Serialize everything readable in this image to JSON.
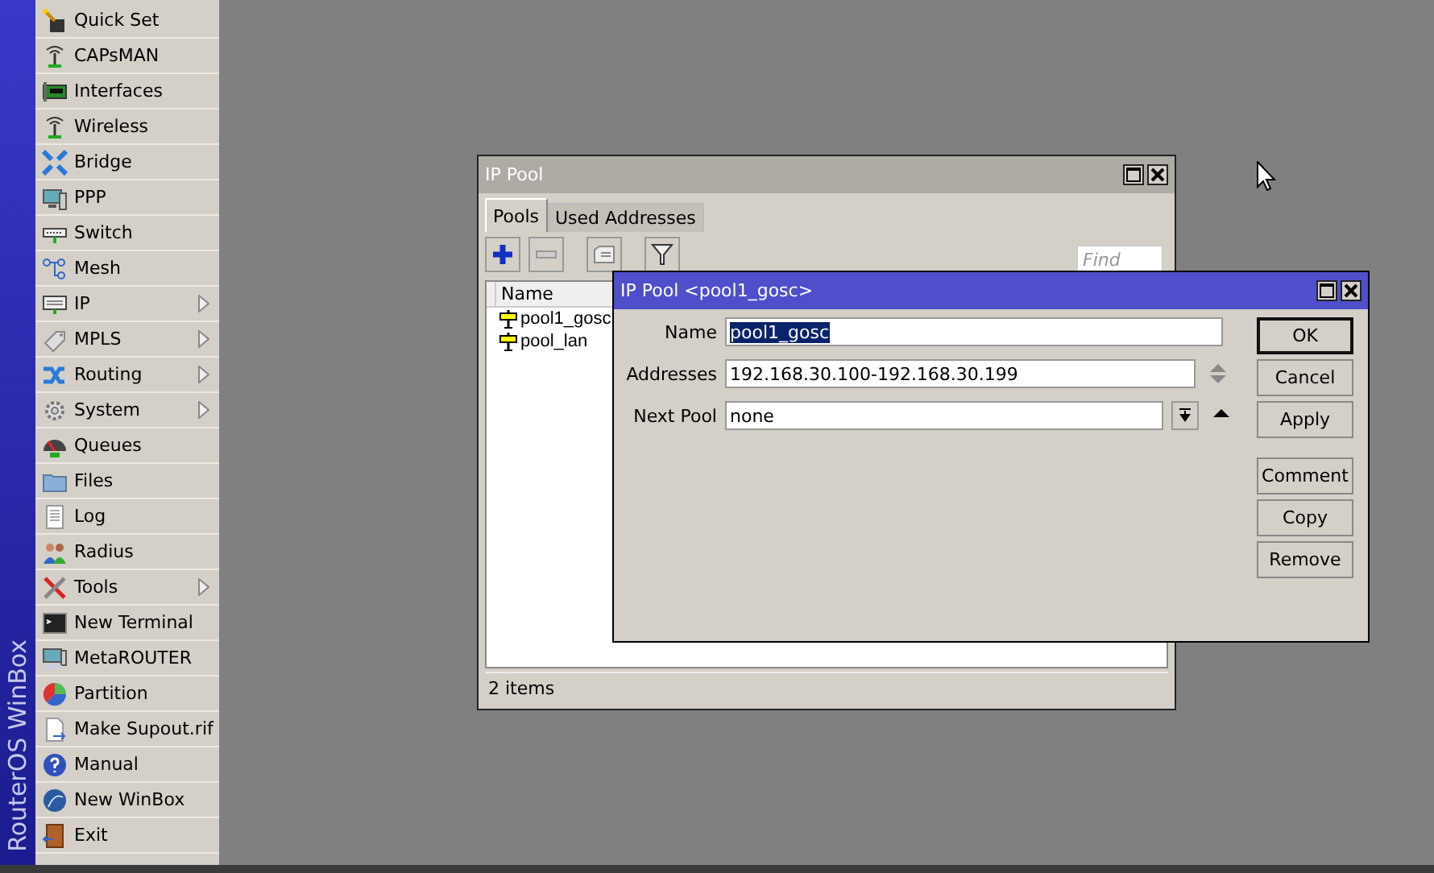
{
  "sidebar": {
    "brand": "RouterOS WinBox",
    "items": [
      {
        "label": "Quick Set",
        "submenu": false
      },
      {
        "label": "CAPsMAN",
        "submenu": false
      },
      {
        "label": "Interfaces",
        "submenu": false
      },
      {
        "label": "Wireless",
        "submenu": false
      },
      {
        "label": "Bridge",
        "submenu": false
      },
      {
        "label": "PPP",
        "submenu": false
      },
      {
        "label": "Switch",
        "submenu": false
      },
      {
        "label": "Mesh",
        "submenu": false
      },
      {
        "label": "IP",
        "submenu": true
      },
      {
        "label": "MPLS",
        "submenu": true
      },
      {
        "label": "Routing",
        "submenu": true
      },
      {
        "label": "System",
        "submenu": true
      },
      {
        "label": "Queues",
        "submenu": false
      },
      {
        "label": "Files",
        "submenu": false
      },
      {
        "label": "Log",
        "submenu": false
      },
      {
        "label": "Radius",
        "submenu": false
      },
      {
        "label": "Tools",
        "submenu": true
      },
      {
        "label": "New Terminal",
        "submenu": false
      },
      {
        "label": "MetaROUTER",
        "submenu": false
      },
      {
        "label": "Partition",
        "submenu": false
      },
      {
        "label": "Make Supout.rif",
        "submenu": false
      },
      {
        "label": "Manual",
        "submenu": false
      },
      {
        "label": "New WinBox",
        "submenu": false
      },
      {
        "label": "Exit",
        "submenu": false
      }
    ]
  },
  "pool_window": {
    "title": "IP Pool",
    "tabs": [
      {
        "label": "Pools",
        "selected": true
      },
      {
        "label": "Used Addresses",
        "selected": false
      }
    ],
    "find": {
      "placeholder": "Find"
    },
    "table": {
      "columns": [
        "Name"
      ],
      "rows": [
        {
          "name": "pool1_gosc"
        },
        {
          "name": "pool_lan"
        }
      ]
    },
    "status_bar": "2 items"
  },
  "dialog": {
    "title": "IP Pool <pool1_gosc>",
    "fields": [
      {
        "label": "Name",
        "value": "pool1_gosc",
        "selected": true,
        "kind": "text"
      },
      {
        "label": "Addresses",
        "value": "192.168.30.100-192.168.30.199",
        "selected": false,
        "kind": "spin"
      },
      {
        "label": "Next Pool",
        "value": "none",
        "selected": false,
        "kind": "dropdown"
      }
    ],
    "buttons": [
      {
        "label": "OK",
        "default": true
      },
      {
        "label": "Cancel",
        "default": false
      },
      {
        "label": "Apply",
        "default": false
      }
    ],
    "record_buttons": [
      {
        "label": "Comment"
      },
      {
        "label": "Copy"
      },
      {
        "label": "Remove"
      }
    ]
  }
}
